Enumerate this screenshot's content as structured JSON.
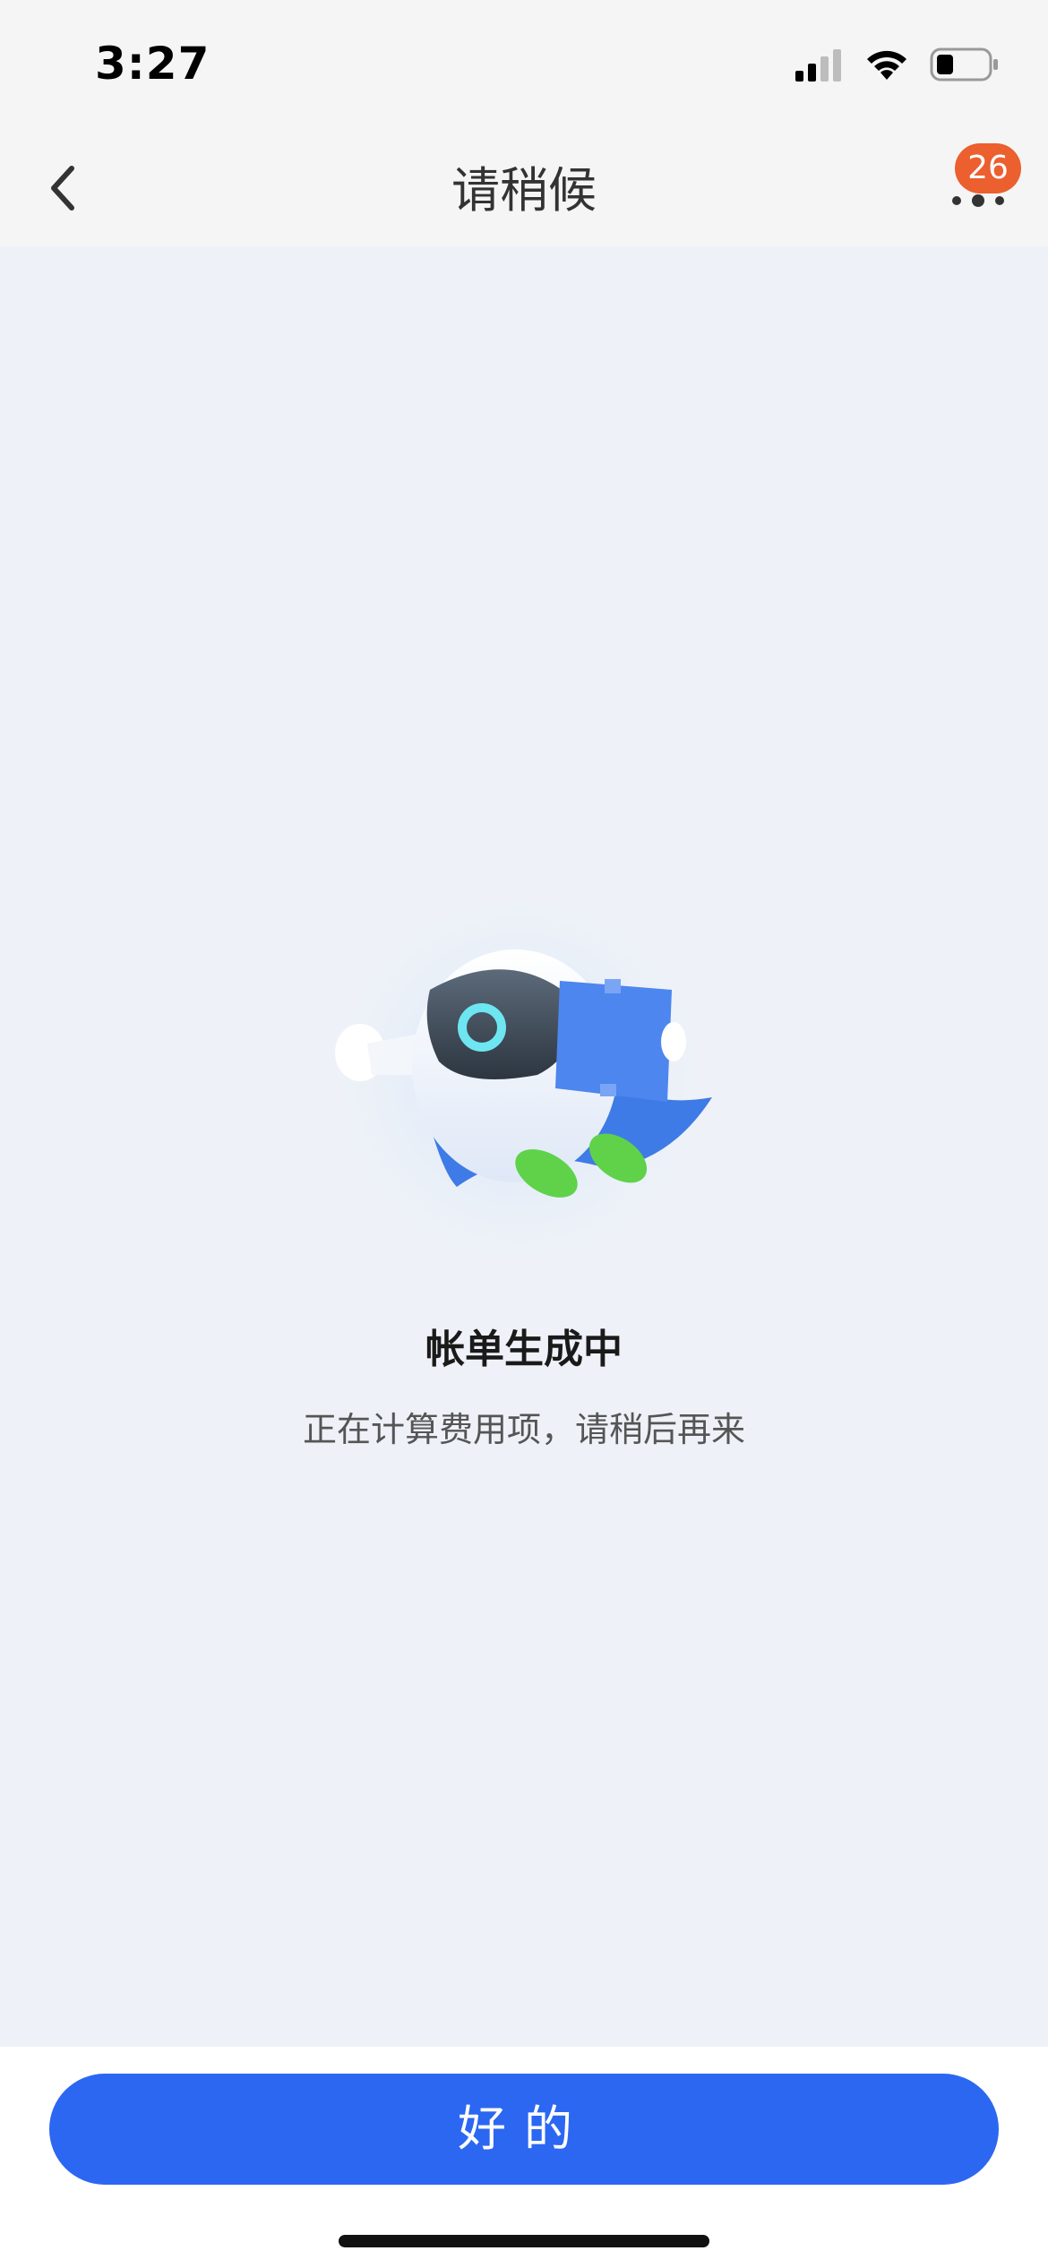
{
  "status_bar": {
    "time": "3:27"
  },
  "nav": {
    "title": "请稍候",
    "badge_count": "26"
  },
  "main": {
    "heading": "帐单生成中",
    "message": "正在计算费用项，请稍后再来"
  },
  "footer": {
    "ok_label": "好的"
  },
  "colors": {
    "primary": "#2c67f2",
    "badge": "#ec5f2f",
    "background": "#eef2f8"
  },
  "icons": [
    "signal-icon",
    "wifi-icon",
    "battery-icon",
    "back-chevron-icon",
    "more-icon",
    "robot-mascot-illustration"
  ]
}
